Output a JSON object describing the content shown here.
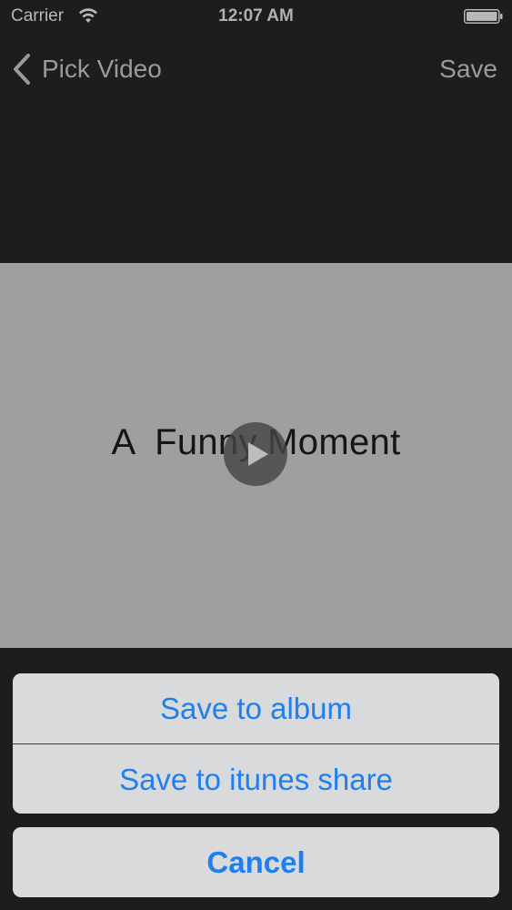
{
  "status_bar": {
    "carrier": "Carrier",
    "time": "12:07 AM",
    "wifi_icon": "wifi-icon",
    "battery_icon": "battery-icon"
  },
  "nav": {
    "back_label": "Pick Video",
    "back_icon": "chevron-left-icon",
    "save_label": "Save"
  },
  "video": {
    "title": "A  Funny Moment",
    "play_icon": "play-icon"
  },
  "action_sheet": {
    "options": [
      {
        "label": "Save to album"
      },
      {
        "label": "Save to itunes share"
      }
    ],
    "cancel_label": "Cancel"
  },
  "colors": {
    "background": "#1b1d1e",
    "video_background": "#a09ea0",
    "sheet_background": "#d9dadb",
    "accent": "#1f7ff0",
    "nav_text": "#9a9a9a"
  }
}
